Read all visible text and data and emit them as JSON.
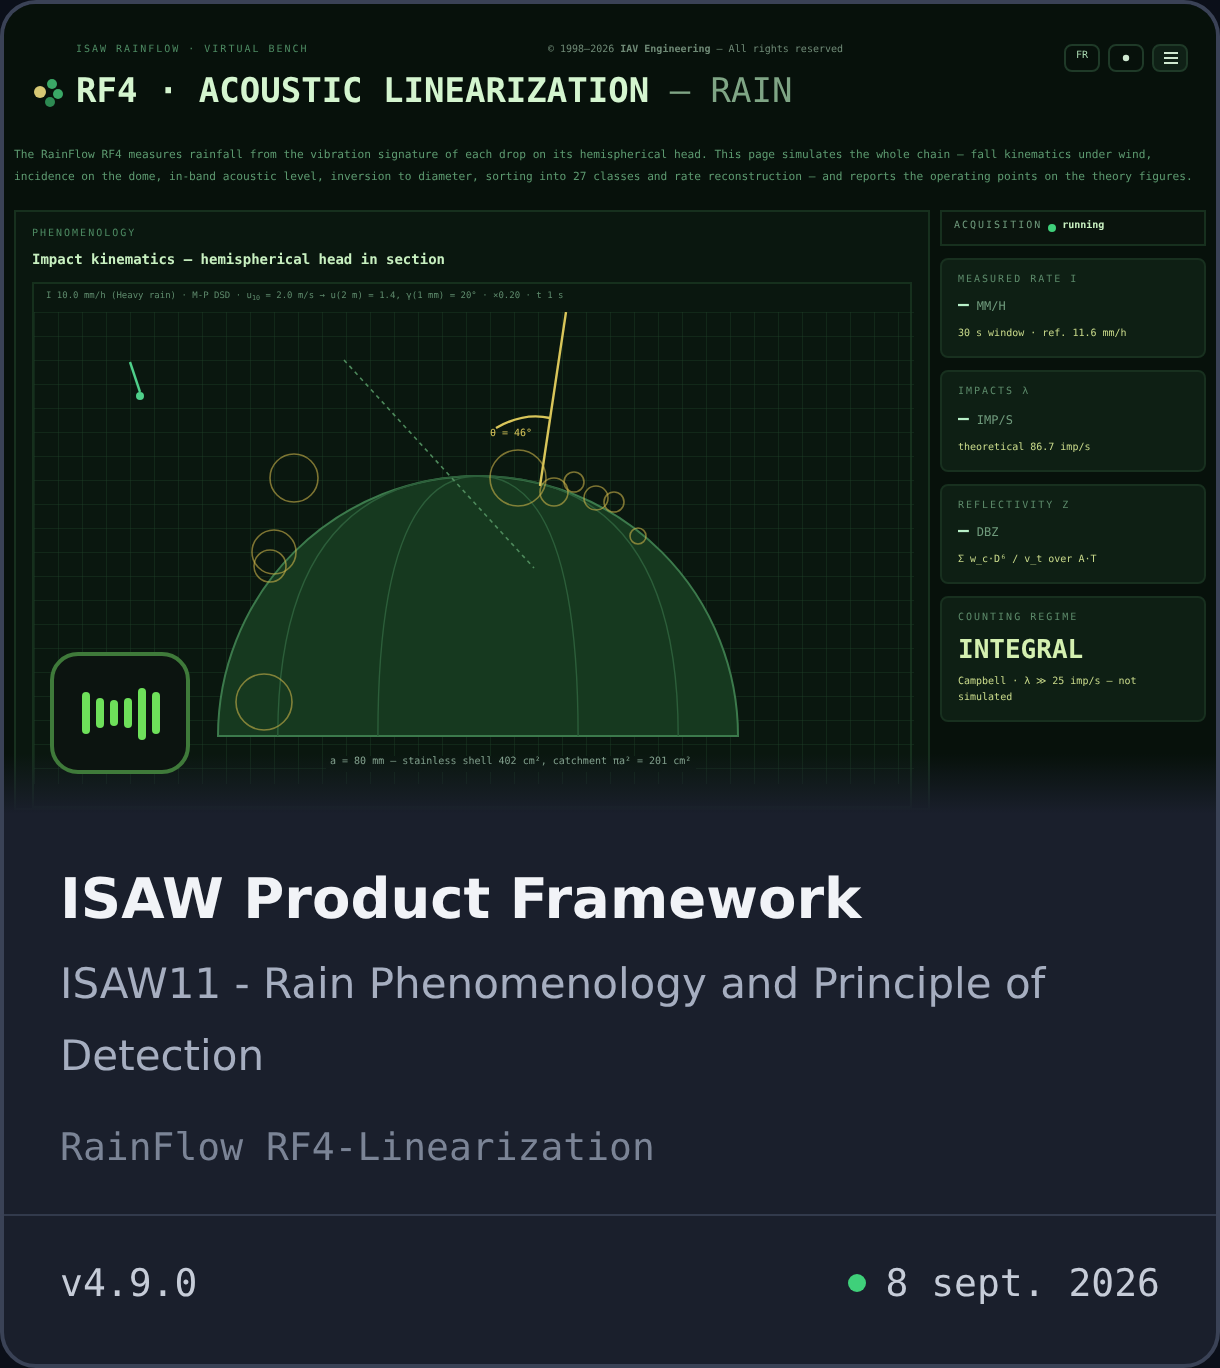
{
  "thumbnail": {
    "kicker": "ISAW RAINFLOW · VIRTUAL BENCH",
    "copyright": "© 1998–2026 **IAV Engineering** — All rights reserved",
    "title": "RF4 · ACOUSTIC LINEARIZATION",
    "title_suffix": "— RAIN",
    "lang_button": "FR",
    "intro": "The RainFlow RF4 measures rainfall from the vibration signature of each drop on its hemispherical head. This page simulates the whole chain — fall kinematics under wind, incidence on the dome, in-band acoustic level, inversion to diameter, sorting into 27 classes and rate reconstruction — and reports the operating points on the theory figures.",
    "panel": {
      "kicker": "PHENOMENOLOGY",
      "title": "Impact kinematics — hemispherical head in section",
      "params": "I 10.0 mm/h (Heavy rain) · M-P DSD · u$_{10}$ = 2.0 m/s → u(2 m) = 1.4, γ(1 mm) = 20° · ×0.20 · t 1 s",
      "angle_label": "θ = 46°",
      "caption": "a = 80 mm — stainless shell 402 cm², catchment πa² = 201 cm²"
    },
    "acquisition": {
      "label": "ACQUISITION",
      "status": "running",
      "running": true
    },
    "cards": [
      {
        "kind": "metric",
        "label": "MEASURED RATE I",
        "value": "—",
        "unit": "MM/H",
        "note": "30 s window · ref. 11.6 mm/h"
      },
      {
        "kind": "metric",
        "label": "IMPACTS λ",
        "value": "—",
        "unit": "IMP/S",
        "note": "theoretical 86.7 imp/s"
      },
      {
        "kind": "metric",
        "label": "REFLECTIVITY Z",
        "value": "—",
        "unit": "DBZ",
        "note": "Σ w_c·D⁶ / v_t over A·T"
      },
      {
        "kind": "regime",
        "label": "COUNTING REGIME",
        "value": "INTEGRAL",
        "note": "Campbell · λ ≫ 25 imp/s — not simulated"
      }
    ]
  },
  "title": "ISAW Product Framework",
  "subtitle": "ISAW11 - Rain Phenomenology and Principle of Detection",
  "product": "RainFlow RF4-Linearization",
  "version": "v4.9.0",
  "date": "8 sept. 2026"
}
